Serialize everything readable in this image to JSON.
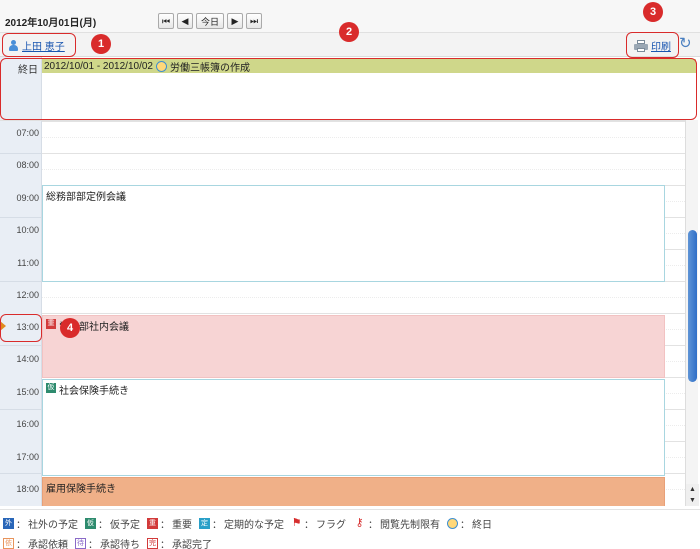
{
  "header": {
    "date": "2012年10月01日(月)",
    "nav": {
      "first": "⏮",
      "prev": "◀",
      "today": "今日",
      "next": "▶",
      "last": "⏭"
    }
  },
  "user": {
    "name": "上田 恵子"
  },
  "toolbar": {
    "print_label": "印刷",
    "refresh_icon": "refresh-icon"
  },
  "allday": {
    "label": "終日",
    "event": {
      "dates": "2012/10/01 - 2012/10/02",
      "title": "労働三帳簿の作成"
    }
  },
  "hours": [
    "07:00",
    "08:00",
    "09:00",
    "10:00",
    "11:00",
    "12:00",
    "13:00",
    "14:00",
    "15:00",
    "16:00",
    "17:00",
    "18:00"
  ],
  "events": [
    {
      "title": "総務部部定例会議",
      "tag": ""
    },
    {
      "title": "営業部社内会議",
      "tag": "重"
    },
    {
      "title": "社会保険手続き",
      "tag": "仮"
    },
    {
      "title": "雇用保険手続き",
      "tag": ""
    }
  ],
  "callouts": [
    "1",
    "2",
    "3",
    "4"
  ],
  "legend": {
    "row1": [
      {
        "icon": "外",
        "sep": "：",
        "label": "社外の予定"
      },
      {
        "icon": "仮",
        "sep": "：",
        "label": "仮予定"
      },
      {
        "icon": "重",
        "sep": "：",
        "label": "重要"
      },
      {
        "icon": "定",
        "sep": "：",
        "label": "定期的な予定"
      },
      {
        "icon": "flag-icon",
        "sep": "：",
        "label": "フラグ"
      },
      {
        "icon": "key-icon",
        "sep": "：",
        "label": "閲覧先制限有"
      },
      {
        "icon": "allday-icon",
        "sep": "：",
        "label": "終日"
      }
    ],
    "row2": [
      {
        "icon": "依",
        "sep": "：",
        "label": "承認依頼"
      },
      {
        "icon": "待",
        "sep": "：",
        "label": "承認待ち"
      },
      {
        "icon": "完",
        "sep": "：",
        "label": "承認完了"
      }
    ]
  },
  "colors": {
    "allday_event": "#cfd78a",
    "important_event": "#f7d4d4",
    "orange_event": "#f0b088",
    "callout": "#d92b2b",
    "link": "#1a56b0"
  }
}
